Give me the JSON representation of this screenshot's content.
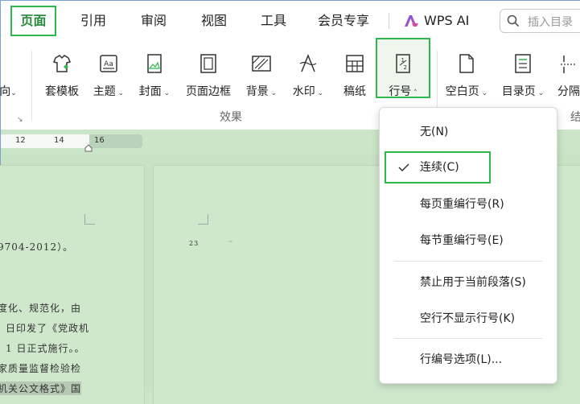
{
  "tabs": [
    {
      "label": "页面",
      "active": true
    },
    {
      "label": "引用"
    },
    {
      "label": "审阅"
    },
    {
      "label": "视图"
    },
    {
      "label": "工具"
    },
    {
      "label": "会员专享"
    }
  ],
  "wps_ai": {
    "label": "WPS AI"
  },
  "search": {
    "placeholder": "插入目录"
  },
  "ribbon": {
    "partial_left": "向",
    "buttons": [
      {
        "label": "套模板",
        "icon": "template-icon"
      },
      {
        "label": "主题",
        "icon": "theme-icon",
        "arrow": "down"
      },
      {
        "label": "封面",
        "icon": "cover-icon",
        "arrow": "down"
      },
      {
        "label": "页面边框",
        "icon": "page-border-icon"
      },
      {
        "label": "背景",
        "icon": "background-icon",
        "arrow": "down"
      },
      {
        "label": "水印",
        "icon": "watermark-icon",
        "arrow": "down"
      },
      {
        "label": "稿纸",
        "icon": "manuscript-icon"
      },
      {
        "label": "行号",
        "icon": "line-number-icon",
        "arrow": "up",
        "active": true
      },
      {
        "label": "空白页",
        "icon": "blank-page-icon",
        "arrow": "down"
      },
      {
        "label": "目录页",
        "icon": "toc-page-icon",
        "arrow": "down"
      },
      {
        "label": "分隔",
        "icon": "break-icon"
      }
    ],
    "group_label": "效果",
    "partial_right_label": "结"
  },
  "ruler": {
    "ticks": [
      "12",
      "14",
      "16"
    ]
  },
  "document": {
    "lines_left": [
      "9704-2012）。",
      "度化、规范化，由",
      "日印发了《党政机",
      "1 日正式施行。。",
      "家质量监督检验检",
      "机关公文格式》国"
    ],
    "page_number": "23",
    "return_mark": "ᵕ"
  },
  "menu": {
    "items": [
      {
        "label": "无(N)"
      },
      {
        "label": "连续(C)",
        "checked": true
      },
      {
        "label": "每页重编行号(R)"
      },
      {
        "label": "每节重编行号(E)"
      },
      {
        "label": "禁止用于当前段落(S)"
      },
      {
        "label": "空行不显示行号(K)"
      },
      {
        "label": "行编号选项(L)..."
      }
    ]
  },
  "colors": {
    "accent": "#2db84d",
    "doc_bg": "#c8e2c5"
  }
}
